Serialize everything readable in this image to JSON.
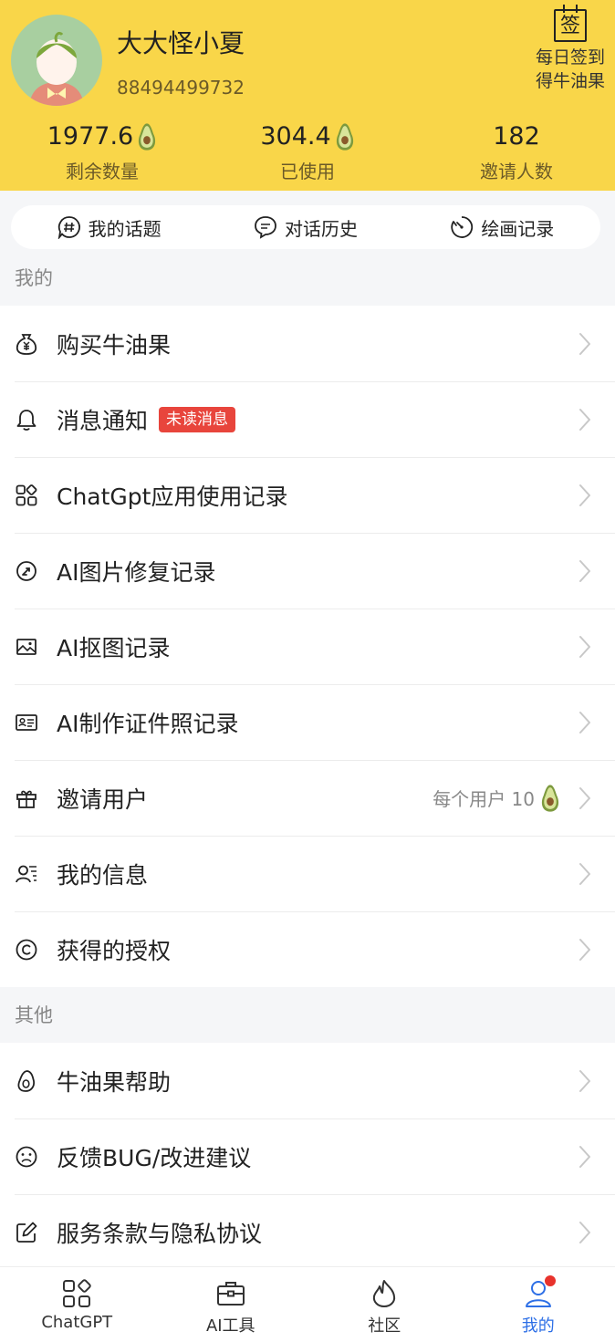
{
  "user": {
    "name": "大大怪小夏",
    "id": "88494499732"
  },
  "checkin": {
    "icon_char": "签",
    "line1": "每日签到",
    "line2": "得牛油果"
  },
  "stats": [
    {
      "value": "1977.6",
      "label": "剩余数量",
      "has_icon": true
    },
    {
      "value": "304.4",
      "label": "已使用",
      "has_icon": true
    },
    {
      "value": "182",
      "label": "邀请人数",
      "has_icon": false
    }
  ],
  "quick_tabs": [
    {
      "label": "我的话题",
      "icon": "hashtag-chat-icon"
    },
    {
      "label": "对话历史",
      "icon": "chat-bubble-icon"
    },
    {
      "label": "绘画记录",
      "icon": "timer-icon"
    }
  ],
  "sections": {
    "mine": "我的",
    "other": "其他"
  },
  "mine_items": [
    {
      "label": "购买牛油果",
      "icon": "money-bag-icon"
    },
    {
      "label": "消息通知",
      "icon": "bell-icon",
      "badge": "未读消息"
    },
    {
      "label": "ChatGpt应用使用记录",
      "icon": "apps-grid-icon"
    },
    {
      "label": "AI图片修复记录",
      "icon": "repair-icon"
    },
    {
      "label": "AI抠图记录",
      "icon": "image-icon"
    },
    {
      "label": "AI制作证件照记录",
      "icon": "id-card-icon"
    },
    {
      "label": "邀请用户",
      "icon": "gift-icon",
      "right_text": "每个用户 10"
    },
    {
      "label": "我的信息",
      "icon": "user-info-icon"
    },
    {
      "label": "获得的授权",
      "icon": "copyright-icon"
    }
  ],
  "other_items": [
    {
      "label": "牛油果帮助",
      "icon": "avocado-outline-icon"
    },
    {
      "label": "反馈BUG/改进建议",
      "icon": "sad-face-icon"
    },
    {
      "label": "服务条款与隐私协议",
      "icon": "edit-icon"
    }
  ],
  "tabbar": [
    {
      "label": "ChatGPT",
      "icon": "apps-grid-icon",
      "active": false
    },
    {
      "label": "AI工具",
      "icon": "toolbox-icon",
      "active": false
    },
    {
      "label": "社区",
      "icon": "flame-icon",
      "active": false
    },
    {
      "label": "我的",
      "icon": "person-icon",
      "active": true
    }
  ],
  "colors": {
    "header_bg": "#f9d649",
    "badge_bg": "#e8453c",
    "active_tab": "#2d6fe6",
    "avocado_skin": "#7d9a3e",
    "avocado_flesh": "#d8e59a"
  }
}
